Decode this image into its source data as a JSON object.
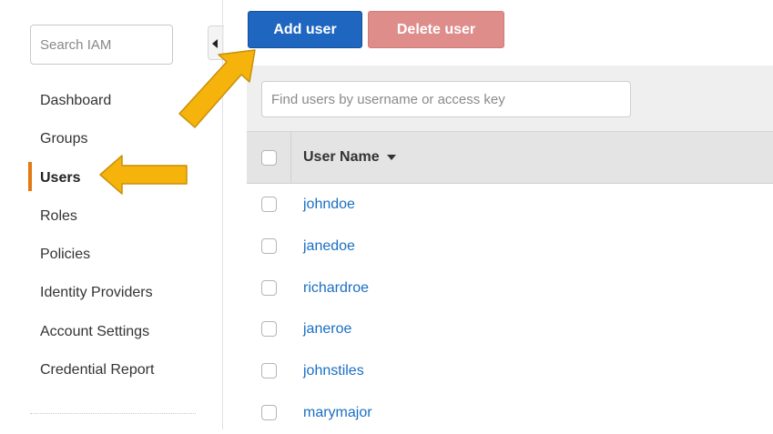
{
  "sidebar": {
    "search_placeholder": "Search IAM",
    "items": [
      {
        "label": "Dashboard"
      },
      {
        "label": "Groups"
      },
      {
        "label": "Users"
      },
      {
        "label": "Roles"
      },
      {
        "label": "Policies"
      },
      {
        "label": "Identity Providers"
      },
      {
        "label": "Account Settings"
      },
      {
        "label": "Credential Report"
      }
    ],
    "active_item": "Users"
  },
  "toolbar": {
    "add_label": "Add user",
    "delete_label": "Delete user"
  },
  "filter": {
    "placeholder": "Find users by username or access key"
  },
  "table": {
    "header_label": "User Name",
    "rows": [
      {
        "username": "johndoe"
      },
      {
        "username": "janedoe"
      },
      {
        "username": "richardroe"
      },
      {
        "username": "janeroe"
      },
      {
        "username": "johnstiles"
      },
      {
        "username": "marymajor"
      }
    ]
  },
  "colors": {
    "primary_button": "#1f66c0",
    "delete_button": "#de8d8b",
    "link": "#1a6fc4",
    "active_marker": "#e47911",
    "annotation_arrow": "#f5b30c"
  },
  "icons": {
    "collapse": "caret-left-icon",
    "sort": "sort-desc-icon",
    "annotation": "arrow-icon"
  }
}
